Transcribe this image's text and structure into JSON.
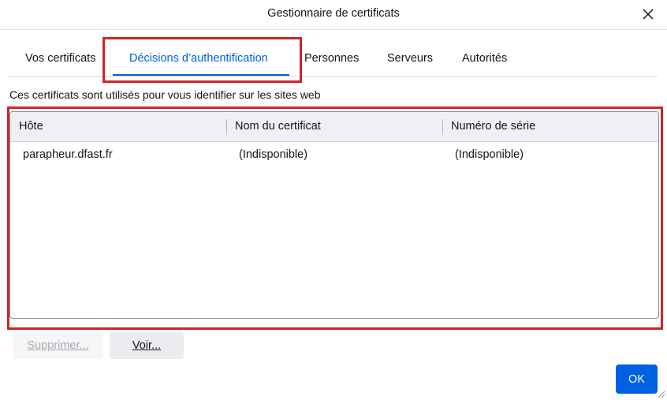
{
  "window": {
    "title": "Gestionnaire de certificats",
    "close_icon": "close-icon"
  },
  "tabs": [
    {
      "label": "Vos certificats",
      "selected": false
    },
    {
      "label": "Décisions d’authentification",
      "selected": true
    },
    {
      "label": "Personnes",
      "selected": false
    },
    {
      "label": "Serveurs",
      "selected": false
    },
    {
      "label": "Autorités",
      "selected": false
    }
  ],
  "description": "Ces certificats sont utilisés pour vous identifier sur les sites web",
  "table": {
    "columns": [
      "Hôte",
      "Nom du certificat",
      "Numéro de série"
    ],
    "rows": [
      {
        "host": "parapheur.dfast.fr",
        "certificate_name": "(Indisponible)",
        "serial_number": "(Indisponible)"
      }
    ]
  },
  "buttons": {
    "delete": "Supprimer...",
    "view": "Voir...",
    "ok": "OK"
  },
  "colors": {
    "accent": "#0061e0",
    "highlight": "#d0242a"
  }
}
